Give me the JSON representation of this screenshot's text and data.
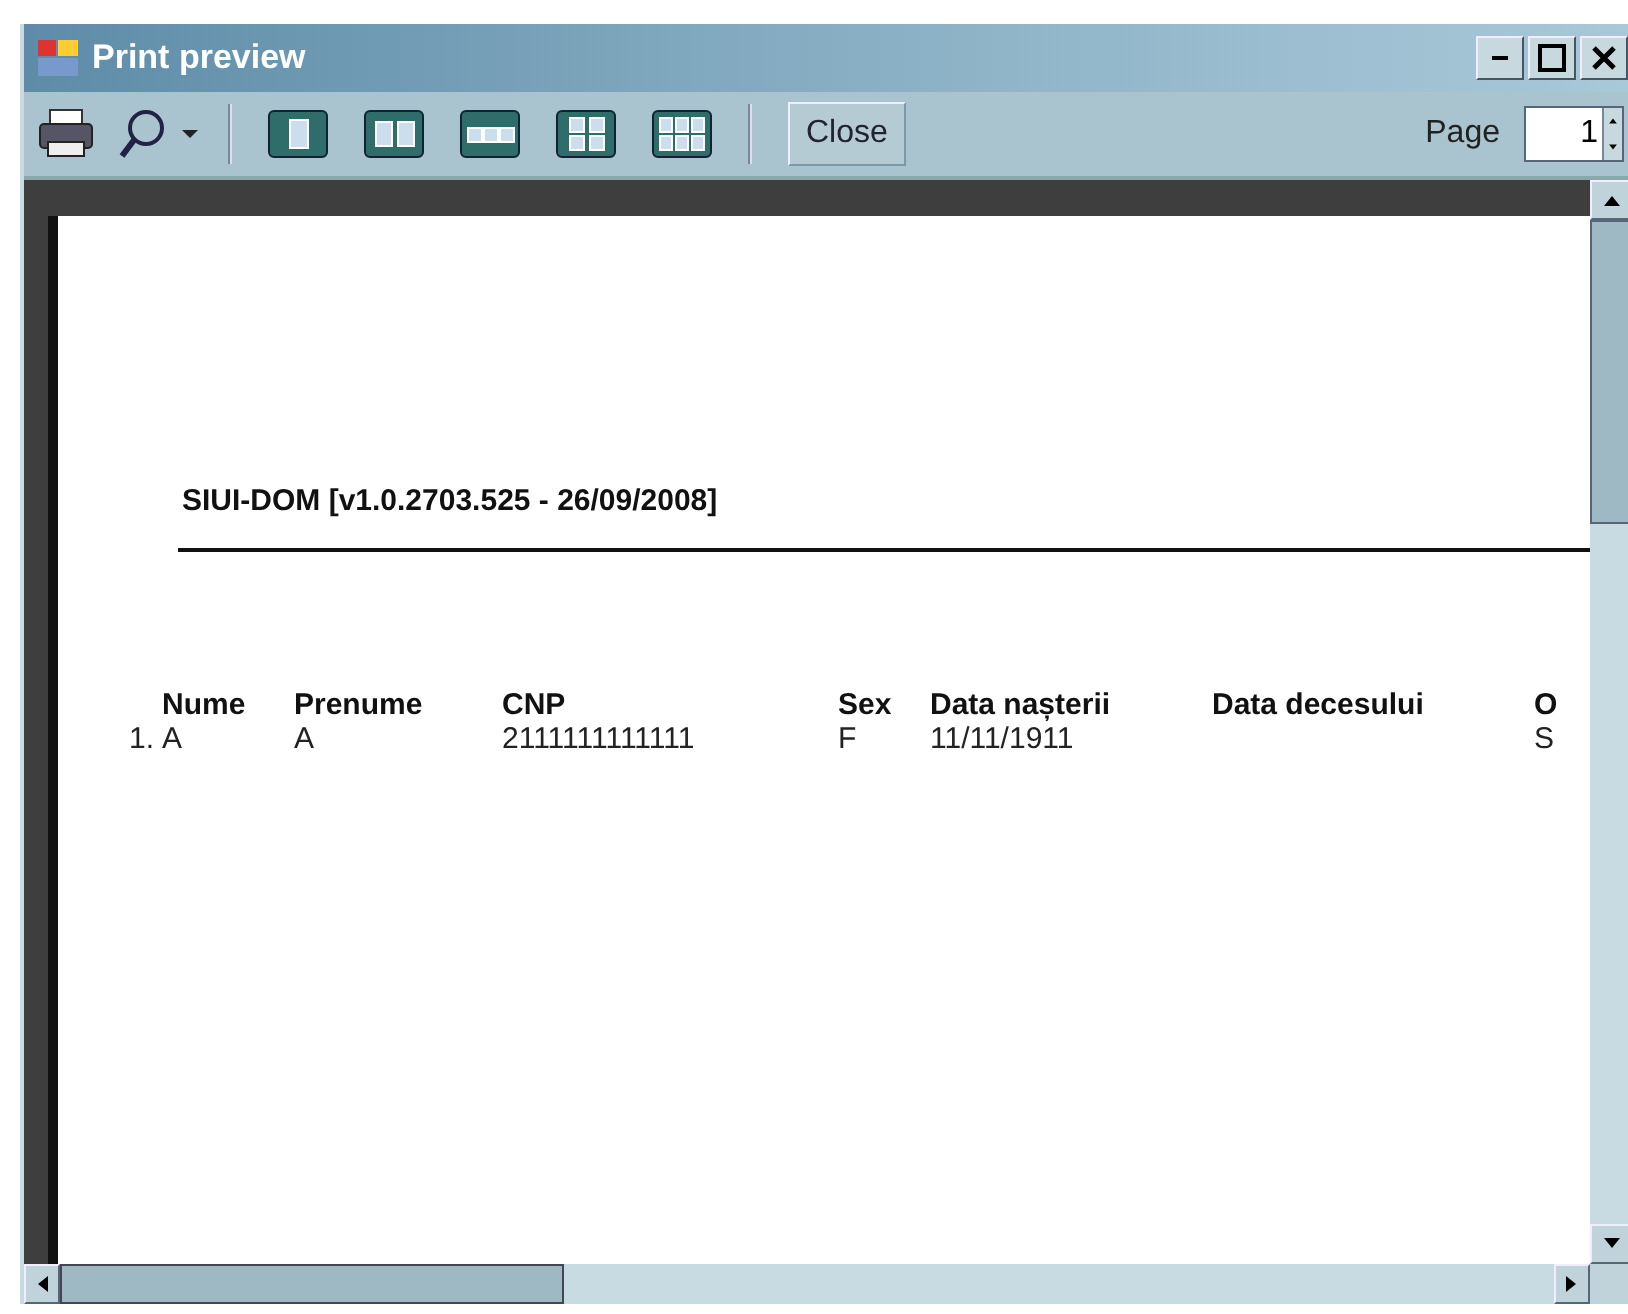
{
  "window": {
    "title": "Print preview"
  },
  "toolbar": {
    "tools": [
      {
        "kind": "print"
      },
      {
        "kind": "zoom"
      }
    ],
    "layouts": [
      {
        "kind": "one"
      },
      {
        "kind": "two"
      },
      {
        "kind": "three"
      },
      {
        "kind": "four"
      },
      {
        "kind": "six"
      }
    ],
    "close_button": "Close",
    "page_label": "Page",
    "page_value": "1"
  },
  "report": {
    "title": "SIUI-DOM [v1.0.2703.525 - 26/09/2008]",
    "columns": [
      "Nume",
      "Prenume",
      "CNP",
      "Sex",
      "Data nașterii",
      "Data decesului",
      "O"
    ],
    "rows": [
      {
        "index": "1.",
        "cells": [
          "A",
          "A",
          "2111111111111",
          "F",
          "11/11/1911",
          "",
          "S"
        ]
      }
    ]
  }
}
